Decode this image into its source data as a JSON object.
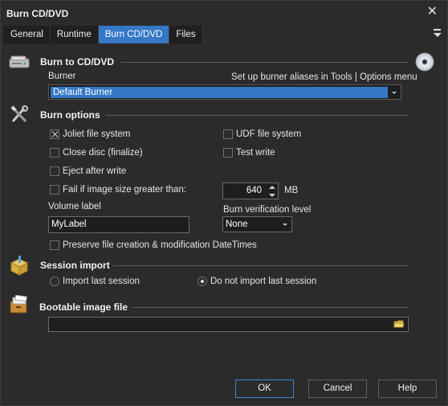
{
  "window": {
    "title": "Burn CD/DVD"
  },
  "tabs": [
    {
      "label": "General",
      "active": false
    },
    {
      "label": "Runtime",
      "active": false
    },
    {
      "label": "Burn CD/DVD",
      "active": true
    },
    {
      "label": "Files",
      "active": false
    }
  ],
  "burn_to": {
    "title": "Burn to CD/DVD",
    "burner_label": "Burner",
    "hint": "Set up burner aliases in Tools | Options menu",
    "burner_value": "Default Burner"
  },
  "options": {
    "title": "Burn options",
    "joliet": {
      "label": "Joliet file system",
      "checked": true
    },
    "udf": {
      "label": "UDF file system",
      "checked": false
    },
    "close_disc": {
      "label": "Close disc (finalize)",
      "checked": false
    },
    "test_write": {
      "label": "Test write",
      "checked": false
    },
    "eject": {
      "label": "Eject after write",
      "checked": false
    },
    "fail_size": {
      "label": "Fail if image size greater than:",
      "checked": false
    },
    "size_value": "640",
    "size_unit": "MB",
    "volume_label": "Volume label",
    "volume_value": "MyLabel",
    "verification_label": "Burn verification level",
    "verification_value": "None",
    "preserve": {
      "label": "Preserve file creation & modification DateTimes",
      "checked": false
    }
  },
  "session": {
    "title": "Session import",
    "import_last": "Import last session",
    "no_import": "Do not import last session",
    "selected": "no_import"
  },
  "bootable": {
    "title": "Bootable image file",
    "path_value": ""
  },
  "buttons": {
    "ok": "OK",
    "cancel": "Cancel",
    "help": "Help"
  },
  "colors": {
    "accent": "#3478c6",
    "background": "#2b2b2b"
  },
  "icons": {
    "close": "close-icon",
    "tab_menu": "menu-icon",
    "burn_section": "disc-drive-icon",
    "disc": "disc-icon",
    "options_section": "tools-icon",
    "session_section": "archive-box-icon",
    "bootable_section": "card-file-icon",
    "browse": "folder-icon"
  }
}
